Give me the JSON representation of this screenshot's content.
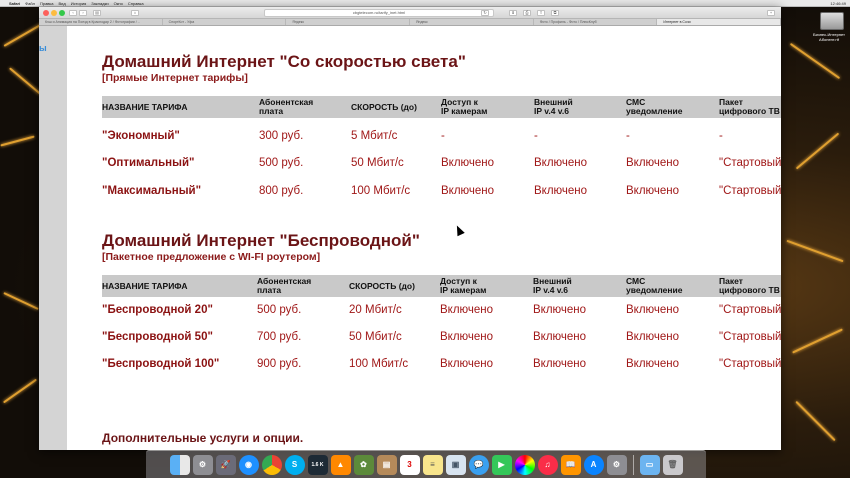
{
  "menubar": {
    "app": "Safari",
    "items": [
      "Файл",
      "Правка",
      "Вид",
      "История",
      "Закладки",
      "Окно",
      "Справка"
    ],
    "clock": "12:46:49"
  },
  "desktop": {
    "drive_label": "Бизнес-Интернет Абонент.rtf"
  },
  "browser": {
    "url": "cbgtelecom.ru/tarify_inet.html",
    "tabs": [
      "Кэш и Анимация на Поезд в Краснодар 2 / Фотографии / ..",
      "СпортКот - Уфа",
      "Яндекс",
      "Яндекс",
      "Фото / Профиль - Фото / ПлюсКлуб",
      "Интернет в Сочи"
    ]
  },
  "page": {
    "left_fragment": "ы",
    "headers": [
      "НАЗВАНИЕ ТАРИФА",
      "Абонентская\nплата",
      "СКОРОСТЬ (до)",
      "Доступ к\nIP камерам",
      "Внешний\nIP v.4 v.6",
      "СМС\nуведомление",
      "Пакет\nцифрового ТВ"
    ],
    "section1": {
      "title": "Домашний Интернет \"Со скоростью света\"",
      "subtitle": "[Прямые Интернет тарифы]",
      "rows": [
        [
          "\"Экономный\"",
          "300 руб.",
          "5 Мбит/с",
          "-",
          "-",
          "-",
          "-"
        ],
        [
          "\"Оптимальный\"",
          "500 руб.",
          "50 Мбит/с",
          "Включено",
          "Включено",
          "Включено",
          "\"Стартовый\""
        ],
        [
          "\"Максимальный\"",
          "800 руб.",
          "100 Мбит/с",
          "Включено",
          "Включено",
          "Включено",
          "\"Стартовый\""
        ]
      ]
    },
    "section2": {
      "title": "Домашний Интернет \"Беспроводной\"",
      "subtitle": "[Пакетное предложение с WI-FI роутером]",
      "rows": [
        [
          "\"Беспроводной 20\"",
          "500 руб.",
          "20 Мбит/с",
          "Включено",
          "Включено",
          "Включено",
          "\"Стартовый\""
        ],
        [
          "\"Беспроводной 50\"",
          "700 руб.",
          "50 Мбит/с",
          "Включено",
          "Включено",
          "Включено",
          "\"Стартовый\""
        ],
        [
          "\"Беспроводной 100\"",
          "900 руб.",
          "100 Мбит/с",
          "Включено",
          "Включено",
          "Включено",
          "\"Стартовый\""
        ]
      ]
    },
    "extra": "Дополнительные услуги и опции."
  },
  "dock": {
    "icons": [
      "finder-icon",
      "launchpad-icon",
      "rocket-icon",
      "safari-icon",
      "chrome-icon",
      "skype-icon",
      "speedtest-icon",
      "vlc-icon",
      "imageviewer-icon",
      "contacts-icon",
      "calendar-icon",
      "notes-icon",
      "preview-icon",
      "messages-icon",
      "facetime-icon",
      "photos-icon",
      "itunes-icon",
      "ibooks-icon",
      "appstore-icon",
      "settings-icon",
      "folder-icon",
      "trash-icon"
    ],
    "calendar_day": "3",
    "speed_text": "1.6 K"
  },
  "colors": {
    "heading": "#6b1416",
    "cell_text": "#a01818",
    "header_bg": "#c9c9c9"
  }
}
